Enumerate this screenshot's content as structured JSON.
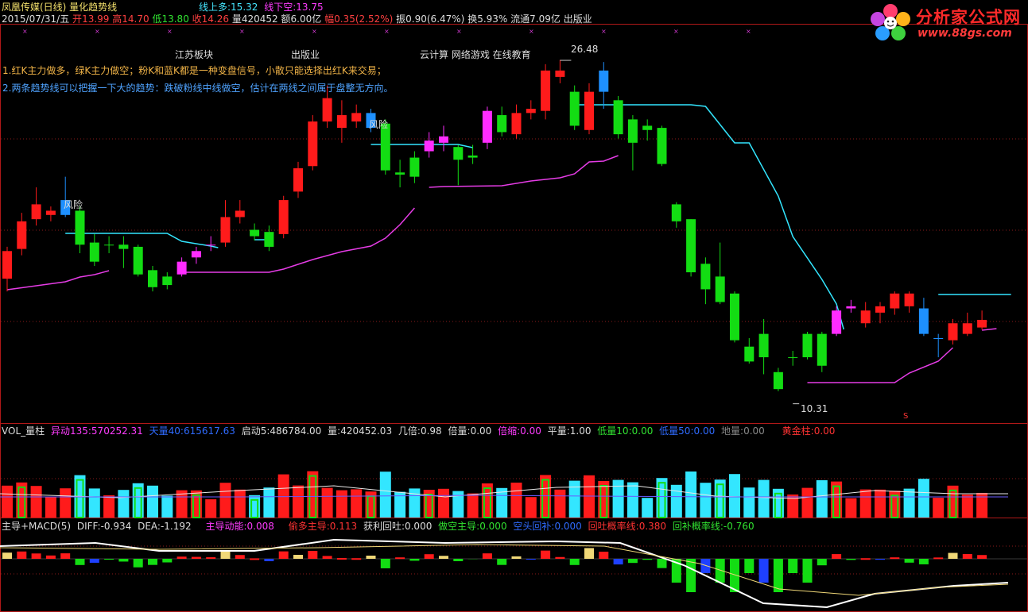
{
  "header": {
    "title_name": "凤凰传媒(日线) 量化趋势线",
    "date": "2015/07/31/五",
    "open_label": "开",
    "open": "13.99",
    "high_label": "高",
    "high": "14.70",
    "low_label": "低",
    "low": "13.80",
    "close_label": "收",
    "close": "14.26",
    "vol_label": "量",
    "vol": "420452",
    "amount_label": "额",
    "amount": "6.00亿",
    "change_label": "幅",
    "change": "0.35(2.52%)",
    "amp_label": "振",
    "amp": "0.90(6.47%)",
    "turnover_label": "换",
    "turnover": "5.93%",
    "float_label": "流通",
    "float": "7.09亿",
    "sector": "出版业",
    "line_long_label": "线上多:",
    "line_long": "15.32",
    "line_short_label": "线下空:",
    "line_short": "13.75"
  },
  "overlay": {
    "tag1": "江苏板块",
    "tag2": "出版业",
    "tag3": "云计算 网络游戏 在线教育",
    "tip1": "1.红K主力做多，绿K主力做空；粉K和蓝K都是一种变盘信号，小散只能选择出红K来交易；",
    "tip2": "2.两条趋势线可以把握一下大的趋势：跌破粉线中线做空，估计在两线之间属于盘整无方向。",
    "risk": "风险",
    "peak_label": "26.48",
    "trough_label": "10.31",
    "s_mark": "S"
  },
  "logo": {
    "title": "分析家公式网",
    "url": "www.88gs.com"
  },
  "vol_panel": {
    "name": "VOL_量柱",
    "yidong_label": "异动135:",
    "yidong": "570252.31",
    "tianliang_label": "天量40:",
    "tianliang": "615617.63",
    "qidong_label": "启动5:",
    "qidong": "486784.00",
    "liang_label": "量:",
    "liang": "420452.03",
    "jibei_label": "几倍:",
    "jibei": "0.98",
    "beiliang_label": "倍量:",
    "beiliang": "0.00",
    "beisuo_label": "倍缩:",
    "beisuo": "0.00",
    "pingliang_label": "平量:",
    "pingliang": "1.00",
    "diliang_label": "低量10:",
    "diliang": "0.00",
    "dililiang_label": "低量50:",
    "dililiang": "0.00",
    "diliang2_label": "地量:",
    "diliang2": "0.00",
    "huangjin_label": "黄金柱:",
    "huangjin": "0.00"
  },
  "macd_panel": {
    "name": "主导+MACD(5)",
    "diff_label": "DIFF:",
    "diff": "-0.934",
    "dea_label": "DEA:",
    "dea": "-1.192",
    "zhudao_label": "主导动能:",
    "zhudao": "0.008",
    "kanduo_label": "偷多主导:",
    "kanduo": "0.113",
    "huotu_label": "获利回吐:",
    "huotu": "0.000",
    "zuokong_label": "做空主导:",
    "zuokong": "0.000",
    "kongtou_label": "空头回补:",
    "kongtou": "0.000",
    "huitu_label": "回吐概率线:",
    "huitu": "0.380",
    "huibu_label": "回补概率线:",
    "huibu": "-0.760"
  },
  "colors": {
    "up": "#ff1b1b",
    "down": "#13dd13",
    "pink": "#ff2cff",
    "blue": "#1e90ff",
    "cyan": "#33e6ff",
    "magenta_line": "#e63ce6",
    "yellow": "#f0d878"
  },
  "chart_data": {
    "type": "candlestick",
    "price_range": [
      9.4,
      28.2
    ],
    "peak": 26.48,
    "trough": 10.31,
    "candles": [
      {
        "o": 16.2,
        "c": 17.5,
        "h": 17.7,
        "l": 15.6,
        "col": "up"
      },
      {
        "o": 17.6,
        "c": 18.9,
        "h": 19.3,
        "l": 17.3,
        "col": "up"
      },
      {
        "o": 19.0,
        "c": 19.7,
        "h": 20.5,
        "l": 18.7,
        "col": "up"
      },
      {
        "o": 19.2,
        "c": 19.4,
        "h": 19.6,
        "l": 18.9,
        "col": "up"
      },
      {
        "o": 19.2,
        "c": 19.9,
        "h": 21.0,
        "l": 19.1,
        "col": "blue"
      },
      {
        "o": 19.4,
        "c": 17.8,
        "h": 19.6,
        "l": 17.4,
        "col": "down"
      },
      {
        "o": 17.9,
        "c": 17.0,
        "h": 18.3,
        "l": 16.8,
        "col": "down"
      },
      {
        "o": 17.8,
        "c": 17.8,
        "h": 18.2,
        "l": 17.4,
        "col": "down"
      },
      {
        "o": 17.8,
        "c": 17.6,
        "h": 18.2,
        "l": 16.7,
        "col": "down"
      },
      {
        "o": 17.7,
        "c": 16.4,
        "h": 17.8,
        "l": 16.3,
        "col": "down"
      },
      {
        "o": 16.6,
        "c": 15.8,
        "h": 16.8,
        "l": 15.6,
        "col": "down"
      },
      {
        "o": 16.3,
        "c": 15.9,
        "h": 16.5,
        "l": 15.7,
        "col": "down"
      },
      {
        "o": 16.4,
        "c": 17.0,
        "h": 17.2,
        "l": 16.3,
        "col": "pink"
      },
      {
        "o": 17.2,
        "c": 17.5,
        "h": 17.7,
        "l": 16.9,
        "col": "pink"
      },
      {
        "o": 17.8,
        "c": 17.8,
        "h": 18.2,
        "l": 17.5,
        "col": "pink"
      },
      {
        "o": 17.9,
        "c": 19.1,
        "h": 19.9,
        "l": 17.7,
        "col": "up"
      },
      {
        "o": 19.1,
        "c": 19.4,
        "h": 19.9,
        "l": 18.8,
        "col": "up"
      },
      {
        "o": 18.5,
        "c": 18.2,
        "h": 18.8,
        "l": 18.0,
        "col": "down"
      },
      {
        "o": 18.4,
        "c": 17.7,
        "h": 18.7,
        "l": 17.5,
        "col": "down"
      },
      {
        "o": 18.3,
        "c": 19.9,
        "h": 20.1,
        "l": 18.1,
        "col": "up"
      },
      {
        "o": 20.3,
        "c": 21.4,
        "h": 21.7,
        "l": 20.0,
        "col": "up"
      },
      {
        "o": 21.5,
        "c": 23.6,
        "h": 23.9,
        "l": 21.3,
        "col": "up"
      },
      {
        "o": 23.6,
        "c": 24.7,
        "h": 25.3,
        "l": 23.3,
        "col": "up"
      },
      {
        "o": 23.3,
        "c": 23.9,
        "h": 24.6,
        "l": 22.6,
        "col": "up"
      },
      {
        "o": 23.6,
        "c": 24.0,
        "h": 24.4,
        "l": 23.3,
        "col": "up"
      },
      {
        "o": 23.3,
        "c": 24.0,
        "h": 24.2,
        "l": 23.1,
        "col": "blue"
      },
      {
        "o": 23.5,
        "c": 21.3,
        "h": 23.7,
        "l": 21.1,
        "col": "down"
      },
      {
        "o": 21.2,
        "c": 21.1,
        "h": 21.8,
        "l": 20.5,
        "col": "down"
      },
      {
        "o": 21.9,
        "c": 21.0,
        "h": 22.2,
        "l": 20.7,
        "col": "down"
      },
      {
        "o": 22.2,
        "c": 22.7,
        "h": 23.1,
        "l": 21.9,
        "col": "pink"
      },
      {
        "o": 22.6,
        "c": 22.9,
        "h": 23.4,
        "l": 22.2,
        "col": "pink"
      },
      {
        "o": 22.4,
        "c": 21.8,
        "h": 22.5,
        "l": 20.6,
        "col": "down"
      },
      {
        "o": 21.9,
        "c": 22.0,
        "h": 22.5,
        "l": 21.6,
        "col": "down"
      },
      {
        "o": 22.6,
        "c": 24.1,
        "h": 24.3,
        "l": 22.3,
        "col": "pink"
      },
      {
        "o": 23.9,
        "c": 23.1,
        "h": 24.3,
        "l": 22.9,
        "col": "down"
      },
      {
        "o": 23.0,
        "c": 24.0,
        "h": 24.4,
        "l": 22.8,
        "col": "up"
      },
      {
        "o": 24.0,
        "c": 24.2,
        "h": 24.6,
        "l": 23.7,
        "col": "up"
      },
      {
        "o": 24.1,
        "c": 26.0,
        "h": 26.3,
        "l": 23.7,
        "col": "up"
      },
      {
        "o": 25.7,
        "c": 26.0,
        "h": 26.5,
        "l": 25.4,
        "col": "up"
      },
      {
        "o": 25.0,
        "c": 23.4,
        "h": 25.3,
        "l": 23.2,
        "col": "down"
      },
      {
        "o": 23.2,
        "c": 25.0,
        "h": 25.4,
        "l": 23.0,
        "col": "up"
      },
      {
        "o": 25.0,
        "c": 26.0,
        "h": 26.4,
        "l": 24.2,
        "col": "blue"
      },
      {
        "o": 24.6,
        "c": 23.0,
        "h": 24.8,
        "l": 22.8,
        "col": "down"
      },
      {
        "o": 23.7,
        "c": 22.6,
        "h": 23.9,
        "l": 21.3,
        "col": "down"
      },
      {
        "o": 23.4,
        "c": 23.2,
        "h": 23.7,
        "l": 22.7,
        "col": "down"
      },
      {
        "o": 23.3,
        "c": 21.6,
        "h": 23.4,
        "l": 21.5,
        "col": "down"
      },
      {
        "o": 19.7,
        "c": 18.9,
        "h": 19.8,
        "l": 18.6,
        "col": "down"
      },
      {
        "o": 19.0,
        "c": 16.5,
        "h": 19.0,
        "l": 16.3,
        "col": "down"
      },
      {
        "o": 16.9,
        "c": 15.7,
        "h": 17.2,
        "l": 15.0,
        "col": "down"
      },
      {
        "o": 16.3,
        "c": 15.1,
        "h": 17.9,
        "l": 15.0,
        "col": "down"
      },
      {
        "o": 15.5,
        "c": 13.3,
        "h": 15.6,
        "l": 13.2,
        "col": "down"
      },
      {
        "o": 13.0,
        "c": 12.3,
        "h": 13.4,
        "l": 12.2,
        "col": "down"
      },
      {
        "o": 13.6,
        "c": 12.5,
        "h": 14.3,
        "l": 11.7,
        "col": "down"
      },
      {
        "o": 11.8,
        "c": 11.0,
        "h": 12.0,
        "l": 10.9,
        "col": "down"
      },
      {
        "o": 12.5,
        "c": 12.5,
        "h": 12.8,
        "l": 12.1,
        "col": "down"
      },
      {
        "o": 12.5,
        "c": 13.6,
        "h": 13.7,
        "l": 12.4,
        "col": "down"
      },
      {
        "o": 13.6,
        "c": 12.1,
        "h": 13.7,
        "l": 11.8,
        "col": "down"
      },
      {
        "o": 13.6,
        "c": 14.7,
        "h": 14.9,
        "l": 13.5,
        "col": "pink"
      },
      {
        "o": 14.8,
        "c": 14.9,
        "h": 15.2,
        "l": 14.6,
        "col": "pink"
      },
      {
        "o": 14.1,
        "c": 14.7,
        "h": 15.1,
        "l": 13.9,
        "col": "up"
      },
      {
        "o": 14.6,
        "c": 14.9,
        "h": 15.1,
        "l": 14.1,
        "col": "up"
      },
      {
        "o": 14.8,
        "c": 15.5,
        "h": 15.6,
        "l": 14.5,
        "col": "up"
      },
      {
        "o": 15.5,
        "c": 14.9,
        "h": 15.6,
        "l": 14.6,
        "col": "up"
      },
      {
        "o": 14.8,
        "c": 13.6,
        "h": 15.3,
        "l": 13.5,
        "col": "blue"
      },
      {
        "o": 13.4,
        "c": 13.4,
        "h": 13.6,
        "l": 12.5,
        "col": "blue"
      },
      {
        "o": 13.3,
        "c": 14.1,
        "h": 14.3,
        "l": 13.1,
        "col": "up"
      },
      {
        "o": 13.6,
        "c": 14.1,
        "h": 14.6,
        "l": 13.5,
        "col": "up"
      },
      {
        "o": 13.9,
        "c": 14.26,
        "h": 14.7,
        "l": 13.8,
        "col": "up"
      }
    ]
  }
}
